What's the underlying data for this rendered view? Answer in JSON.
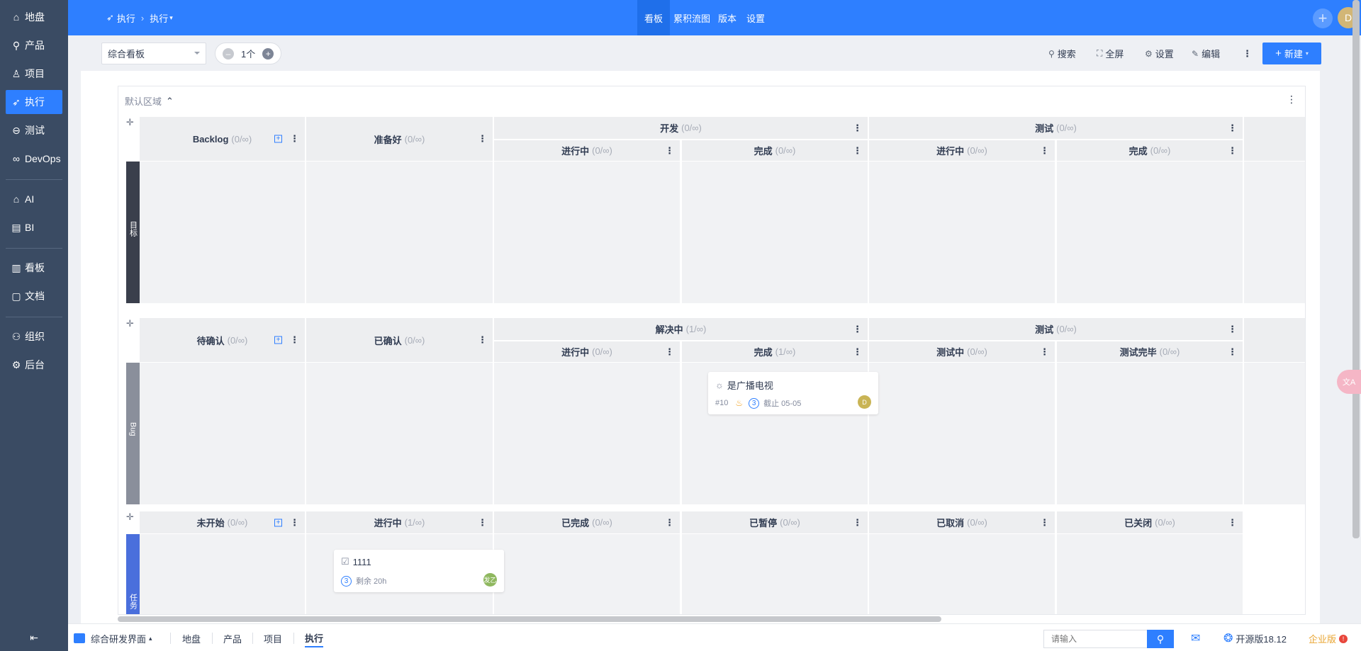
{
  "sidebar": {
    "items": [
      {
        "label": "地盘",
        "icon": "home-icon"
      },
      {
        "label": "产品",
        "icon": "location-pin-icon"
      },
      {
        "label": "项目",
        "icon": "project-icon"
      },
      {
        "label": "执行",
        "icon": "rocket-icon",
        "active": true
      },
      {
        "label": "测试",
        "icon": "test-icon"
      },
      {
        "label": "DevOps",
        "icon": "devops-icon"
      },
      {
        "label": "AI",
        "icon": "robot-icon"
      },
      {
        "label": "BI",
        "icon": "bi-chart-icon"
      },
      {
        "label": "看板",
        "icon": "kanban-icon"
      },
      {
        "label": "文档",
        "icon": "document-icon"
      },
      {
        "label": "组织",
        "icon": "people-icon"
      },
      {
        "label": "后台",
        "icon": "gear-icon"
      }
    ],
    "collapse_glyph": "⇤"
  },
  "topbar": {
    "breadcrumb_root": "执行",
    "breadcrumb_current": "执行",
    "nav": [
      "看板",
      "累积流图",
      "版本",
      "设置"
    ],
    "active_nav": "看板",
    "avatar_letter": "D",
    "accent_color": "#2e7fff"
  },
  "toolbar": {
    "kanban_select": "综合看板",
    "stepper_value": "1个",
    "search": "搜索",
    "fullscreen": "全屏",
    "settings": "设置",
    "edit": "编辑",
    "new": "新建"
  },
  "board": {
    "region_title": "默认区域",
    "lanes": [
      {
        "name": "目标",
        "color": "#3a3f4c",
        "columns": [
          {
            "label": "Backlog",
            "count": "(0/∞)"
          },
          {
            "label": "准备好",
            "count": "(0/∞)"
          },
          {
            "label": "开发",
            "count": "(0/∞)",
            "children": [
              {
                "label": "进行中",
                "count": "(0/∞)"
              },
              {
                "label": "完成",
                "count": "(0/∞)"
              }
            ]
          },
          {
            "label": "测试",
            "count": "(0/∞)",
            "children": [
              {
                "label": "进行中",
                "count": "(0/∞)"
              },
              {
                "label": "完成",
                "count": "(0/∞)"
              }
            ]
          }
        ]
      },
      {
        "name": "Bug",
        "color": "#8a8f9b",
        "columns": [
          {
            "label": "待确认",
            "count": "(0/∞)"
          },
          {
            "label": "已确认",
            "count": "(0/∞)"
          },
          {
            "label": "解决中",
            "count": "(1/∞)",
            "children": [
              {
                "label": "进行中",
                "count": "(0/∞)"
              },
              {
                "label": "完成",
                "count": "(1/∞)"
              }
            ]
          },
          {
            "label": "测试",
            "count": "(0/∞)",
            "children": [
              {
                "label": "测试中",
                "count": "(0/∞)"
              },
              {
                "label": "测试完毕",
                "count": "(0/∞)"
              }
            ]
          }
        ],
        "card": {
          "title": "是广播电视",
          "id": "#10",
          "pri": "3",
          "due": "截止 05-05",
          "assignee": "D"
        }
      },
      {
        "name": "任务",
        "color": "#4a6fdc",
        "columns": [
          {
            "label": "未开始",
            "count": "(0/∞)"
          },
          {
            "label": "进行中",
            "count": "(1/∞)"
          },
          {
            "label": "已完成",
            "count": "(0/∞)"
          },
          {
            "label": "已暂停",
            "count": "(0/∞)"
          },
          {
            "label": "已取消",
            "count": "(0/∞)"
          },
          {
            "label": "已关闭",
            "count": "(0/∞)"
          }
        ],
        "card": {
          "title": "1111",
          "pri": "3",
          "left": "剩余 20h",
          "assignee": "发乙"
        }
      }
    ]
  },
  "bottombar": {
    "app": "综合研发界面",
    "tabs": [
      "地盘",
      "产品",
      "项目",
      "执行"
    ],
    "active_tab": "执行",
    "search_placeholder": "请输入",
    "version": "开源版18.12",
    "edition": "企业版"
  }
}
